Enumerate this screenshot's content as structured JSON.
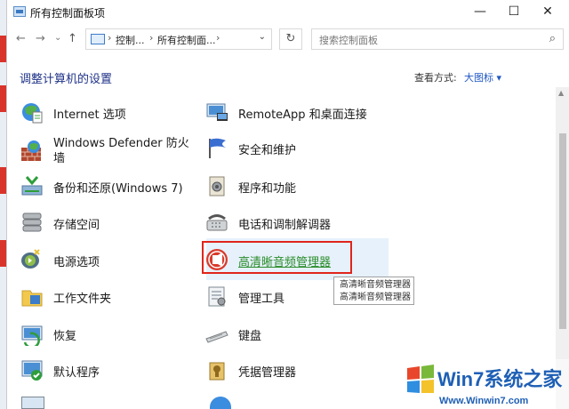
{
  "window": {
    "title": "所有控制面板项",
    "controls": {
      "minimize": "—",
      "maximize": "☐",
      "close": "✕"
    }
  },
  "nav": {
    "back": "←",
    "forward": "→",
    "history": "⌄",
    "up": "↑",
    "address": {
      "seg1": "控制...",
      "sep1": "›",
      "seg2": "所有控制面...",
      "sep2": "›",
      "sep0": "›",
      "dropdown": "⌄"
    },
    "refresh": "↻",
    "search_placeholder": "搜索控制面板",
    "search_icon": "⌕"
  },
  "header": {
    "title": "调整计算机的设置",
    "view_by_label": "查看方式:",
    "view_by_value": "大图标 ▾"
  },
  "left_items": [
    {
      "label": "Internet 选项",
      "icon": "internet-options-icon"
    },
    {
      "label": "Windows Defender 防火",
      "label2": "墙",
      "icon": "firewall-icon"
    },
    {
      "label": "备份和还原(Windows 7)",
      "icon": "backup-restore-icon"
    },
    {
      "label": "存储空间",
      "icon": "storage-spaces-icon"
    },
    {
      "label": "电源选项",
      "icon": "power-options-icon"
    },
    {
      "label": "工作文件夹",
      "icon": "work-folders-icon"
    },
    {
      "label": "恢复",
      "icon": "recovery-icon"
    },
    {
      "label": "默认程序",
      "icon": "default-programs-icon"
    }
  ],
  "right_items": [
    {
      "label": "RemoteApp 和桌面连接",
      "icon": "remoteapp-icon"
    },
    {
      "label": "安全和维护",
      "icon": "security-maintenance-icon"
    },
    {
      "label": "程序和功能",
      "icon": "programs-features-icon"
    },
    {
      "label": "电话和调制解调器",
      "icon": "phone-modem-icon"
    },
    {
      "label": "高清晰音频管理器",
      "icon": "hd-audio-manager-icon",
      "highlighted": true
    },
    {
      "label": "管理工具",
      "icon": "admin-tools-icon"
    },
    {
      "label": "键盘",
      "icon": "keyboard-icon"
    },
    {
      "label": "凭据管理器",
      "icon": "credential-manager-icon"
    }
  ],
  "tooltip": {
    "line1": "高清晰音频管理器",
    "line2": "高清晰音频管理器"
  },
  "watermark": {
    "brand": "Win7系统之家",
    "url": "Www.Winwin7.com"
  },
  "colors": {
    "highlight_border": "#e0251b",
    "link_hover_text": "#2a8c2a",
    "heading": "#1e3287",
    "accent": "#1f57c4"
  }
}
